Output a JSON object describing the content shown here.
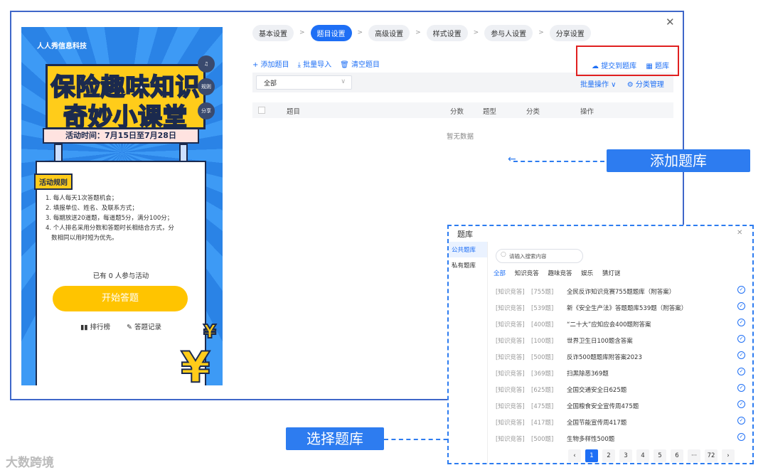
{
  "promo": {
    "company": "人人秀信息科技",
    "title_line1": "保险趣味知识",
    "title_line2": "奇妙小课堂",
    "time": "活动时间：7月15日至7月28日",
    "side_rules": "规则",
    "side_share": "分享",
    "rules_tag": "活动规则",
    "rules": [
      "1. 每人每天1次答题机会；",
      "2. 填报单位、姓名、及联系方式；",
      "3. 每期放送20道题，每道题5分，满分100分；",
      "4. 个人排名采用分数和答题时长相结合方式，分",
      "   数相同以用时短为优先。"
    ],
    "participants": "已有 0 人参与活动",
    "start_btn": "开始答题",
    "ranking": "排行榜",
    "records": "答题记录",
    "yen": "¥"
  },
  "steps": [
    "基本设置",
    "题目设置",
    "高级设置",
    "样式设置",
    "参与人设置",
    "分享设置"
  ],
  "toolbar": {
    "add": "+ 添加题目",
    "import": "⤓ 批量导入",
    "clear": "🗑 清空题目"
  },
  "filter": {
    "selected": "全部"
  },
  "actions": {
    "submit": "提交到题库",
    "bank": "题库",
    "batch": "批量操作 ∨",
    "category": "分类管理"
  },
  "table": {
    "headers": [
      "题目",
      "分数",
      "题型",
      "分类",
      "操作"
    ],
    "empty": "暂无数据"
  },
  "callouts": {
    "add_bank": "添加题库",
    "select_bank": "选择题库"
  },
  "modal": {
    "title": "题库",
    "side": [
      "公共题库",
      "私有题库"
    ],
    "search_placeholder": "请输入搜索内容",
    "cats": [
      "全部",
      "知识竞答",
      "趣味竞答",
      "娱乐",
      "猜灯谜"
    ],
    "rows": [
      {
        "cat": "[知识竞答]",
        "cnt": "[755题]",
        "name": "全民反诈知识竞赛755题题库（附答案）"
      },
      {
        "cat": "[知识竞答]",
        "cnt": "[539题]",
        "name": "新《安全生产法》答题题库539题（附答案）"
      },
      {
        "cat": "[知识竞答]",
        "cnt": "[400题]",
        "name": "“二十大”应知应会400题附答案"
      },
      {
        "cat": "[知识竞答]",
        "cnt": "[100题]",
        "name": "世界卫生日100题含答案"
      },
      {
        "cat": "[知识竞答]",
        "cnt": "[500题]",
        "name": "反诈500题题库附答案2023"
      },
      {
        "cat": "[知识竞答]",
        "cnt": "[369题]",
        "name": "扫黑除恶369题"
      },
      {
        "cat": "[知识竞答]",
        "cnt": "[625题]",
        "name": "全国交通安全日625题"
      },
      {
        "cat": "[知识竞答]",
        "cnt": "[475题]",
        "name": "全国粮食安全宣传周475题"
      },
      {
        "cat": "[知识竞答]",
        "cnt": "[417题]",
        "name": "全国节能宣传周417题"
      },
      {
        "cat": "[知识竞答]",
        "cnt": "[500题]",
        "name": "生物多样性500题"
      }
    ],
    "pages": [
      "‹",
      "1",
      "2",
      "3",
      "4",
      "5",
      "6",
      "···",
      "72",
      "›"
    ]
  },
  "watermark": "大数跨境",
  "colors": {
    "accent": "#1e6ff5",
    "highlight": "#e02020",
    "callout": "#2d7cf0"
  }
}
